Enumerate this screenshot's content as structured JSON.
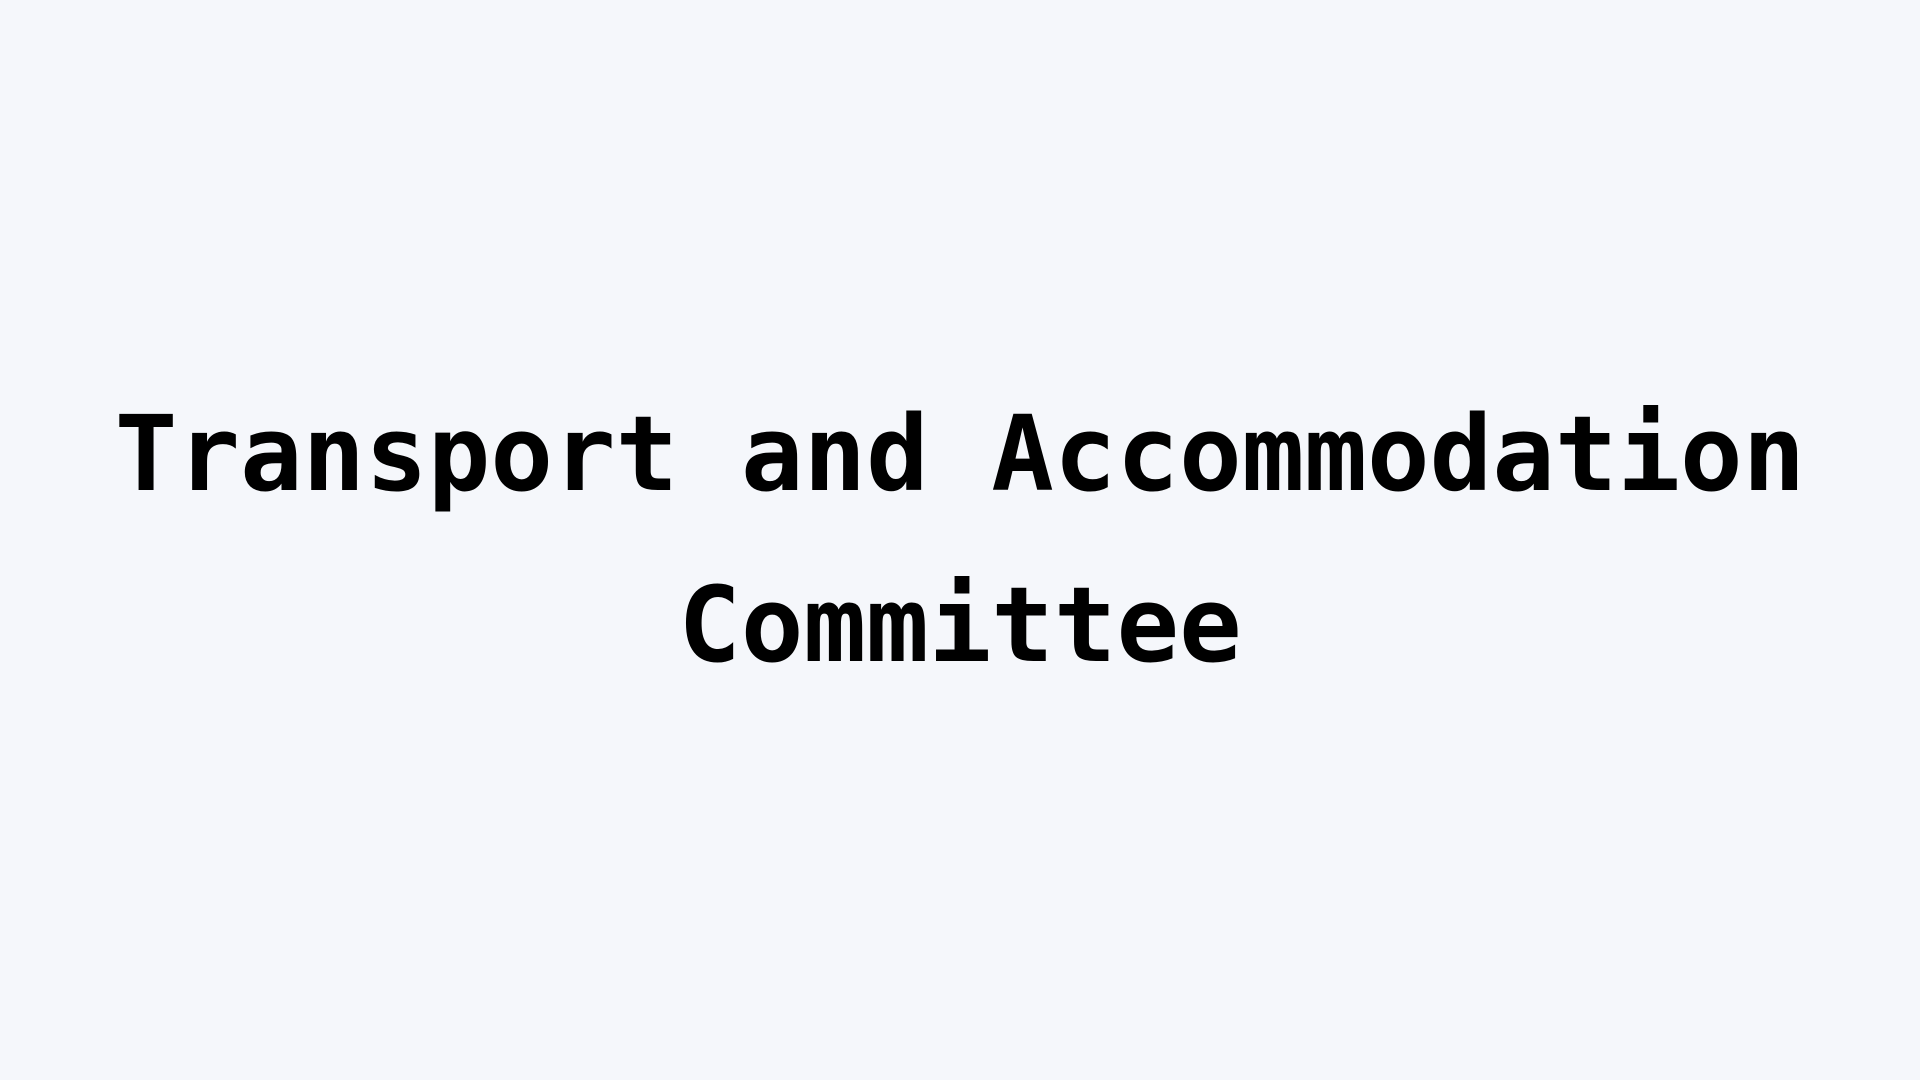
{
  "slide": {
    "title": "Transport and Accommodation Committee"
  },
  "colors": {
    "background": "#f5f7fb",
    "text": "#000000"
  }
}
